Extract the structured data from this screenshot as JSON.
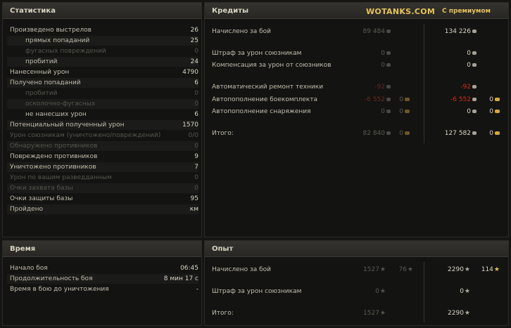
{
  "stats": {
    "title": "Статистика",
    "rows": [
      {
        "label": "Произведено выстрелов",
        "value": "26",
        "dim": false,
        "indent": false
      },
      {
        "label": "прямых попаданий",
        "value": "25",
        "dim": false,
        "indent": true
      },
      {
        "label": "фугасных повреждений",
        "value": "0",
        "dim": true,
        "indent": true
      },
      {
        "label": "пробитий",
        "value": "24",
        "dim": false,
        "indent": true
      },
      {
        "label": "Нанесенный урон",
        "value": "4790",
        "dim": false,
        "indent": false
      },
      {
        "label": "Получено попаданий",
        "value": "6",
        "dim": false,
        "indent": false
      },
      {
        "label": "пробитий",
        "value": "0",
        "dim": true,
        "indent": true
      },
      {
        "label": "осколочно-фугасных",
        "value": "0",
        "dim": true,
        "indent": true
      },
      {
        "label": "не нанесших урон",
        "value": "6",
        "dim": false,
        "indent": true
      },
      {
        "label": "Потенциальный полученный урон",
        "value": "1570",
        "dim": false,
        "indent": false
      },
      {
        "label": "Урон союзникам (уничтожено/повреждений)",
        "value": "0/0",
        "dim": true,
        "indent": false
      },
      {
        "label": "Обнаружено противников",
        "value": "0",
        "dim": true,
        "indent": false
      },
      {
        "label": "Повреждено противников",
        "value": "9",
        "dim": false,
        "indent": false
      },
      {
        "label": "Уничтожено противников",
        "value": "7",
        "dim": false,
        "indent": false
      },
      {
        "label": "Урон по вашим разведданным",
        "value": "0",
        "dim": true,
        "indent": false
      },
      {
        "label": "Очки захвата базы",
        "value": "0",
        "dim": true,
        "indent": false
      },
      {
        "label": "Очки защиты базы",
        "value": "95",
        "dim": false,
        "indent": false
      },
      {
        "label": "Пройдено",
        "value": "км",
        "dim": false,
        "indent": false
      }
    ]
  },
  "credits": {
    "title": "Кредиты",
    "brand": "WOTANKS.COM",
    "premium_label": "С премиумом",
    "rows": [
      {
        "label": "Начислено за бой",
        "base": "89 484",
        "base_style": "dim",
        "base_gold": "",
        "prem": "134 226",
        "prem_style": "",
        "prem_gold": ""
      },
      {
        "label": "Штраф за урон союзникам",
        "base": "0",
        "base_style": "dim",
        "base_gold": "",
        "prem": "0",
        "prem_style": "",
        "prem_gold": ""
      },
      {
        "label": "Компенсация за урон от союзников",
        "base": "0",
        "base_style": "dim",
        "base_gold": "",
        "prem": "0",
        "prem_style": "",
        "prem_gold": ""
      },
      {
        "label": "Автоматический ремонт техники",
        "base": "-92",
        "base_style": "dimred",
        "base_gold": "",
        "prem": "-92",
        "prem_style": "red",
        "prem_gold": ""
      },
      {
        "label": "Автопополнение боекомплекта",
        "base": "-6 552",
        "base_style": "dimred",
        "base_gold": "0",
        "prem": "-6 552",
        "prem_style": "red",
        "prem_gold": "0"
      },
      {
        "label": "Автопополнение снаряжения",
        "base": "0",
        "base_style": "dim",
        "base_gold": "0",
        "prem": "0",
        "prem_style": "",
        "prem_gold": "0"
      },
      {
        "label": "Итого:",
        "base": "82 840",
        "base_style": "dim",
        "base_gold": "0",
        "prem": "127 582",
        "prem_style": "",
        "prem_gold": "0"
      }
    ]
  },
  "time": {
    "title": "Время",
    "rows": [
      {
        "label": "Начало боя",
        "value": "06:45"
      },
      {
        "label": "Продолжительность боя",
        "value": "8 мин 17 с"
      },
      {
        "label": "Время в бою до уничтожения",
        "value": "-"
      }
    ]
  },
  "xp": {
    "title": "Опыт",
    "rows": [
      {
        "label": "Начислено за бой",
        "base": "1527",
        "base_free": "76",
        "prem": "2290",
        "prem_free": "114"
      },
      {
        "label": "Штраф за урон союзникам",
        "base": "0",
        "base_free": "",
        "prem": "0",
        "prem_free": ""
      },
      {
        "label": "Итого:",
        "base": "1527",
        "base_free": "",
        "prem": "2290",
        "prem_free": ""
      }
    ]
  }
}
